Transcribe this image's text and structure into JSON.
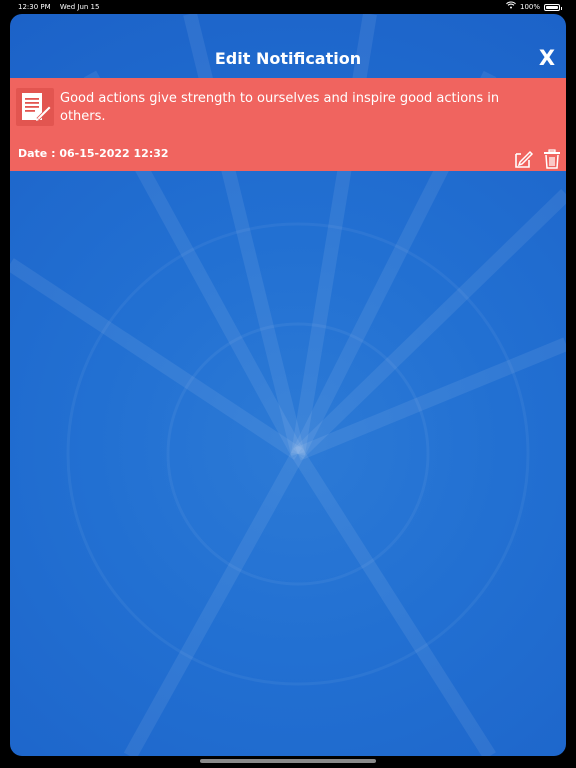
{
  "status_bar": {
    "time": "12:30 PM",
    "date": "Wed Jun 15",
    "battery": "100%",
    "battery_level": 1.0,
    "wifi_icon": "wifi-icon"
  },
  "header": {
    "title": "Edit Notification",
    "close_label": "X"
  },
  "notification": {
    "icon": "note-edit-icon",
    "message": "Good actions give strength to ourselves and inspire good actions in others.",
    "date_text": "Date : 06-15-2022 12:32",
    "edit_icon": "edit-icon",
    "delete_icon": "trash-icon"
  },
  "colors": {
    "background": "#1f67cc",
    "card": "#f0645f",
    "text": "#ffffff"
  }
}
